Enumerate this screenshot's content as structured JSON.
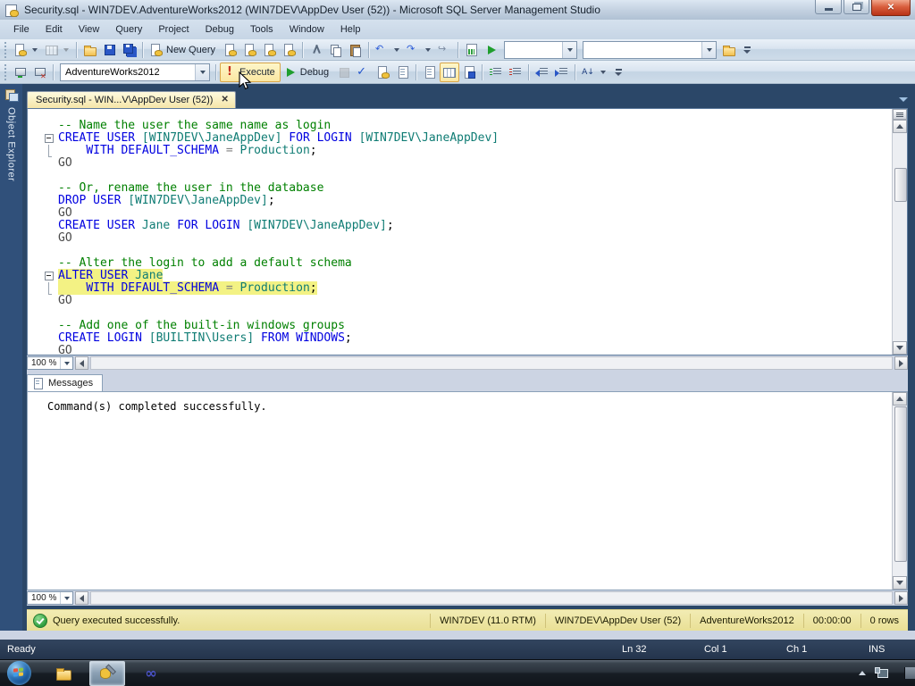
{
  "window": {
    "title": "Security.sql - WIN7DEV.AdventureWorks2012 (WIN7DEV\\AppDev User (52)) - Microsoft SQL Server Management Studio"
  },
  "menu": {
    "items": [
      "File",
      "Edit",
      "View",
      "Query",
      "Project",
      "Debug",
      "Tools",
      "Window",
      "Help"
    ]
  },
  "toolbars": {
    "standard": [
      {
        "k": "grip"
      },
      {
        "k": "icon",
        "n": "new-query-template",
        "ic": "dbpage",
        "dd": true
      },
      {
        "k": "icon",
        "n": "add-item",
        "ic": "grid",
        "dd": true,
        "dis": true
      },
      {
        "k": "sep"
      },
      {
        "k": "icon",
        "n": "open-file",
        "ic": "folder"
      },
      {
        "k": "icon",
        "n": "save",
        "ic": "save"
      },
      {
        "k": "icon",
        "n": "save-all",
        "ic": "saveall"
      },
      {
        "k": "sep"
      },
      {
        "k": "btn",
        "n": "new-query",
        "ic": "dbpage",
        "label": "New Query"
      },
      {
        "k": "icon",
        "n": "database-engine-query",
        "ic": "dbpage"
      },
      {
        "k": "icon",
        "n": "mdx-query",
        "ic": "dbpage"
      },
      {
        "k": "icon",
        "n": "dmx-query",
        "ic": "dbpage"
      },
      {
        "k": "icon",
        "n": "xmla-query",
        "ic": "dbpage"
      },
      {
        "k": "sep"
      },
      {
        "k": "icon",
        "n": "cut",
        "ic": "cut"
      },
      {
        "k": "icon",
        "n": "copy",
        "ic": "copy"
      },
      {
        "k": "icon",
        "n": "paste",
        "ic": "paste"
      },
      {
        "k": "sep"
      },
      {
        "k": "icon",
        "n": "undo",
        "ic": "g blue",
        "g": "↶",
        "dd": true
      },
      {
        "k": "icon",
        "n": "redo",
        "ic": "g blue",
        "g": "↷",
        "dd": true
      },
      {
        "k": "icon",
        "n": "navigate-forward",
        "ic": "g gray",
        "g": "↪"
      },
      {
        "k": "sep"
      },
      {
        "k": "icon",
        "n": "activity-monitor",
        "ic": "chart"
      },
      {
        "k": "icon",
        "n": "start-debugging",
        "ic": "play"
      },
      {
        "k": "combo",
        "n": "toolbar-combo-1",
        "v": "",
        "w": 82
      },
      {
        "k": "combo",
        "n": "toolbar-combo-2",
        "v": "",
        "w": 150
      },
      {
        "k": "icon",
        "n": "find-in-files",
        "ic": "folderfind"
      },
      {
        "k": "overflow"
      }
    ],
    "sql_editor": [
      {
        "k": "grip"
      },
      {
        "k": "icon",
        "n": "change-connection",
        "ic": "server"
      },
      {
        "k": "icon",
        "n": "disconnect",
        "ic": "server xred"
      },
      {
        "k": "sep"
      },
      {
        "k": "combo",
        "n": "available-databases",
        "v": "AdventureWorks2012",
        "w": 168
      },
      {
        "k": "sep"
      },
      {
        "k": "btn",
        "n": "execute",
        "ic": "excl",
        "g": "!",
        "label": "Execute",
        "hot": true
      },
      {
        "k": "btn",
        "n": "debug",
        "ic": "play",
        "label": "Debug"
      },
      {
        "k": "icon",
        "n": "stop-execution",
        "ic": "stop",
        "dis": true
      },
      {
        "k": "icon",
        "n": "parse",
        "ic": "g check",
        "g": "✓"
      },
      {
        "k": "icon",
        "n": "display-estimated-plan",
        "ic": "dbpage"
      },
      {
        "k": "icon",
        "n": "query-options",
        "ic": "rtext"
      },
      {
        "k": "sep"
      },
      {
        "k": "icon",
        "n": "results-to-text",
        "ic": "rtext"
      },
      {
        "k": "icon",
        "n": "results-to-grid",
        "ic": "rgrid",
        "sel": true
      },
      {
        "k": "icon",
        "n": "results-to-file",
        "ic": "rfile"
      },
      {
        "k": "sep"
      },
      {
        "k": "icon",
        "n": "comment-selection",
        "ic": "comment"
      },
      {
        "k": "icon",
        "n": "uncomment-selection",
        "ic": "uncomment"
      },
      {
        "k": "sep"
      },
      {
        "k": "icon",
        "n": "decrease-indent",
        "ic": "outdent"
      },
      {
        "k": "icon",
        "n": "increase-indent",
        "ic": "indent"
      },
      {
        "k": "sep"
      },
      {
        "k": "icon",
        "n": "sort-az",
        "ic": "g az",
        "g": "A↓",
        "dd": true
      },
      {
        "k": "overflow"
      }
    ]
  },
  "object_explorer": {
    "label": "Object Explorer"
  },
  "editor": {
    "tab_label": "Security.sql - WIN...V\\AppDev User (52))",
    "tab_close": "✕",
    "zoom_value": "100 %"
  },
  "code": {
    "lines": [
      {
        "segs": [
          {
            "t": "-- Name the user the same name as login",
            "c": "cm"
          }
        ]
      },
      {
        "fold": "minus",
        "segs": [
          {
            "t": "CREATE USER ",
            "c": "kw"
          },
          {
            "t": "[WIN7DEV\\JaneAppDev]",
            "c": "id"
          },
          {
            "t": " ",
            "c": "pl"
          },
          {
            "t": "FOR LOGIN ",
            "c": "kw"
          },
          {
            "t": "[WIN7DEV\\JaneAppDev]",
            "c": "id"
          }
        ]
      },
      {
        "fold": "bar",
        "segs": [
          {
            "t": "    ",
            "c": "pl"
          },
          {
            "t": "WITH DEFAULT_SCHEMA ",
            "c": "kw"
          },
          {
            "t": "= ",
            "c": "op"
          },
          {
            "t": "Production",
            "c": "id"
          },
          {
            "t": ";",
            "c": "pl"
          }
        ]
      },
      {
        "segs": [
          {
            "t": "GO",
            "c": "go"
          }
        ]
      },
      {
        "segs": []
      },
      {
        "segs": [
          {
            "t": "-- Or, rename the user in the database",
            "c": "cm"
          }
        ]
      },
      {
        "segs": [
          {
            "t": "DROP USER ",
            "c": "kw"
          },
          {
            "t": "[WIN7DEV\\JaneAppDev]",
            "c": "id"
          },
          {
            "t": ";",
            "c": "pl"
          }
        ]
      },
      {
        "segs": [
          {
            "t": "GO",
            "c": "go"
          }
        ]
      },
      {
        "segs": [
          {
            "t": "CREATE USER ",
            "c": "kw"
          },
          {
            "t": "Jane",
            "c": "id"
          },
          {
            "t": " ",
            "c": "pl"
          },
          {
            "t": "FOR LOGIN ",
            "c": "kw"
          },
          {
            "t": "[WIN7DEV\\JaneAppDev]",
            "c": "id"
          },
          {
            "t": ";",
            "c": "pl"
          }
        ]
      },
      {
        "segs": [
          {
            "t": "GO",
            "c": "go"
          }
        ]
      },
      {
        "segs": []
      },
      {
        "segs": [
          {
            "t": "-- Alter the login to add a default schema",
            "c": "cm"
          }
        ]
      },
      {
        "fold": "minus",
        "hl": true,
        "segs": [
          {
            "t": "ALTER USER ",
            "c": "kw"
          },
          {
            "t": "Jane",
            "c": "id"
          }
        ]
      },
      {
        "fold": "bar",
        "hl": true,
        "segs": [
          {
            "t": "    ",
            "c": "pl"
          },
          {
            "t": "WITH DEFAULT_SCHEMA ",
            "c": "kw"
          },
          {
            "t": "= ",
            "c": "op"
          },
          {
            "t": "Production",
            "c": "id"
          },
          {
            "t": ";",
            "c": "pl"
          }
        ]
      },
      {
        "segs": [
          {
            "t": "GO",
            "c": "go"
          }
        ]
      },
      {
        "segs": []
      },
      {
        "segs": [
          {
            "t": "-- Add one of the built-in windows groups",
            "c": "cm"
          }
        ]
      },
      {
        "segs": [
          {
            "t": "CREATE LOGIN ",
            "c": "kw"
          },
          {
            "t": "[BUILTIN\\Users]",
            "c": "id"
          },
          {
            "t": " ",
            "c": "pl"
          },
          {
            "t": "FROM WINDOWS",
            "c": "kw"
          },
          {
            "t": ";",
            "c": "pl"
          }
        ]
      },
      {
        "segs": [
          {
            "t": "GO",
            "c": "go"
          }
        ]
      }
    ]
  },
  "results": {
    "tab_label": "Messages",
    "message": "Command(s) completed successfully.",
    "zoom_value": "100 %"
  },
  "query_status": {
    "text": "Query executed successfully.",
    "segments": [
      {
        "n": "server-name",
        "t": "WIN7DEV (11.0 RTM)"
      },
      {
        "n": "user-name",
        "t": "WIN7DEV\\AppDev User (52)"
      },
      {
        "n": "database-name",
        "t": "AdventureWorks2012"
      },
      {
        "n": "execution-time",
        "t": "00:00:00"
      },
      {
        "n": "row-count",
        "t": "0 rows"
      }
    ]
  },
  "status_bar": {
    "state": "Ready",
    "segments": [
      {
        "n": "line-number",
        "t": "Ln 32"
      },
      {
        "n": "column-number",
        "t": "Col 1"
      },
      {
        "n": "character-number",
        "t": "Ch 1"
      },
      {
        "n": "insert-mode",
        "t": "INS",
        "ins": true
      }
    ]
  },
  "taskbar": {
    "buttons": [
      {
        "n": "taskbar-windows-explorer",
        "ic": "explorer"
      },
      {
        "n": "taskbar-ssms",
        "ic": "ssms",
        "active": true
      },
      {
        "n": "taskbar-blend",
        "ic": "infinity",
        "g": "∞"
      }
    ]
  }
}
